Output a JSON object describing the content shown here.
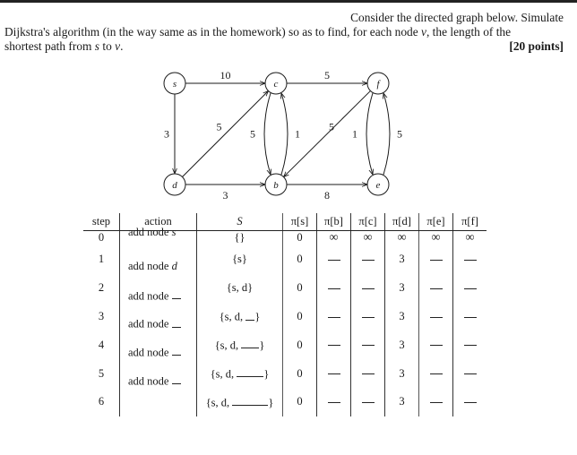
{
  "problem": {
    "line1": "Consider the directed graph below.  Simulate",
    "line2_pre": "Dijkstra's algorithm (in the way same as in the homework) so as to find, for each node ",
    "line2_var": "v",
    "line2_post": ", the length of the",
    "line3_pre": "shortest path from ",
    "line3_s": "s",
    "line3_mid": " to ",
    "line3_v": "v",
    "line3_end": ".",
    "points": "[20 points]"
  },
  "graph": {
    "nodes": [
      {
        "id": "s",
        "label": "s",
        "col": 0,
        "row": 0
      },
      {
        "id": "c",
        "label": "c",
        "col": 1,
        "row": 0
      },
      {
        "id": "f",
        "label": "f",
        "col": 2,
        "row": 0
      },
      {
        "id": "d",
        "label": "d",
        "col": 0,
        "row": 1
      },
      {
        "id": "b",
        "label": "b",
        "col": 1,
        "row": 1
      },
      {
        "id": "e",
        "label": "e",
        "col": 2,
        "row": 1
      }
    ],
    "edges": [
      {
        "from": "s",
        "to": "c",
        "weight": "10",
        "shape": "straight"
      },
      {
        "from": "s",
        "to": "d",
        "weight": "3",
        "shape": "straight"
      },
      {
        "from": "d",
        "to": "c",
        "weight": "5",
        "shape": "straight"
      },
      {
        "from": "d",
        "to": "b",
        "weight": "3",
        "shape": "straight"
      },
      {
        "from": "c",
        "to": "f",
        "weight": "5",
        "shape": "straight"
      },
      {
        "from": "c",
        "to": "b",
        "weight": "5",
        "shape": "arc-left"
      },
      {
        "from": "b",
        "to": "c",
        "weight": "1",
        "shape": "arc-right"
      },
      {
        "from": "f",
        "to": "b",
        "weight": "5",
        "shape": "straight"
      },
      {
        "from": "b",
        "to": "e",
        "weight": "8",
        "shape": "straight"
      },
      {
        "from": "f",
        "to": "e",
        "weight": "1",
        "shape": "arc-left"
      },
      {
        "from": "e",
        "to": "f",
        "weight": "5",
        "shape": "arc-right"
      }
    ]
  },
  "table": {
    "headers": {
      "step": "step",
      "action": "action",
      "set": "S",
      "pi": [
        "π[s]",
        "π[b]",
        "π[c]",
        "π[d]",
        "π[e]",
        "π[f]"
      ]
    },
    "rows": [
      {
        "step": "0",
        "set": "{}",
        "pi": [
          "0",
          "∞",
          "∞",
          "∞",
          "∞",
          "∞"
        ]
      },
      {
        "step": "1",
        "set": "{s}",
        "pi": [
          "0",
          "—",
          "—",
          "3",
          "—",
          "—"
        ]
      },
      {
        "step": "2",
        "set": "{s, d}",
        "pi": [
          "0",
          "—",
          "—",
          "3",
          "—",
          "—"
        ]
      },
      {
        "step": "3",
        "set": "{s, d, _}",
        "pi": [
          "0",
          "—",
          "—",
          "3",
          "—",
          "—"
        ]
      },
      {
        "step": "4",
        "set": "{s, d, __}",
        "pi": [
          "0",
          "—",
          "—",
          "3",
          "—",
          "—"
        ]
      },
      {
        "step": "5",
        "set": "{s, d, ___}",
        "pi": [
          "0",
          "—",
          "—",
          "3",
          "—",
          "—"
        ]
      },
      {
        "step": "6",
        "set": "{s, d, ____}",
        "pi": [
          "0",
          "—",
          "—",
          "3",
          "—",
          "—"
        ]
      }
    ],
    "actions": [
      {
        "prefix": "add node ",
        "node": "s"
      },
      {
        "prefix": "add node ",
        "node": "d"
      },
      {
        "prefix": "add node ",
        "node": ""
      },
      {
        "prefix": "add node ",
        "node": ""
      },
      {
        "prefix": "add node ",
        "node": ""
      },
      {
        "prefix": "add node ",
        "node": ""
      }
    ]
  }
}
